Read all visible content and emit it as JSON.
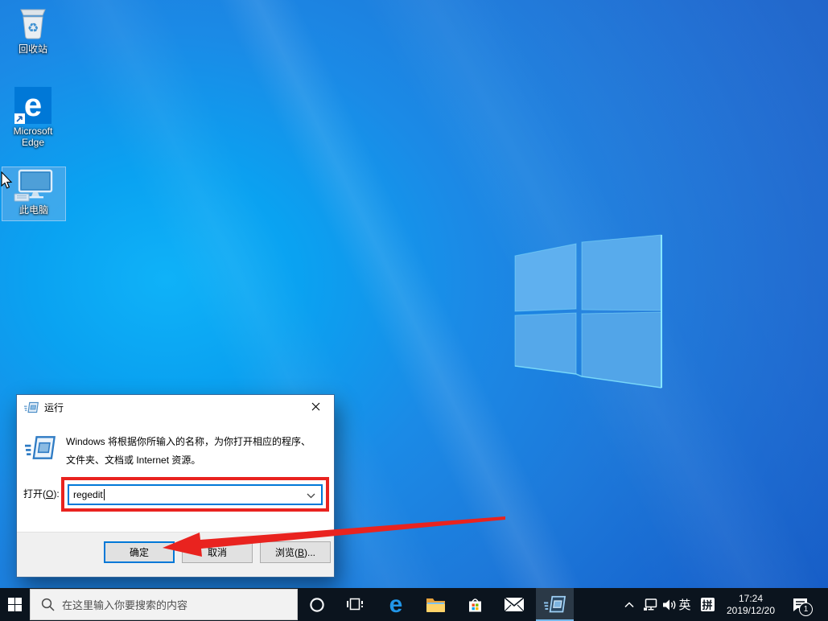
{
  "desktop_icons": [
    {
      "label": "回收站"
    },
    {
      "label": "Microsoft Edge"
    },
    {
      "label": "此电脑",
      "selected": true
    }
  ],
  "icons": {
    "edge_glyph": "e",
    "recycle_glyph": "♻"
  },
  "run_dialog": {
    "title": "运行",
    "message_line1": "Windows 将根据你所输入的名称，为你打开相应的程序、",
    "message_line2": "文件夹、文档或 Internet 资源。",
    "open_label": {
      "prefix": "打开(",
      "key": "O",
      "suffix": "):"
    },
    "input_value": "regedit",
    "buttons": {
      "ok": "确定",
      "cancel": "取消",
      "browse": {
        "prefix": "浏览(",
        "key": "B",
        "suffix": ")..."
      }
    }
  },
  "taskbar": {
    "search_placeholder": "在这里输入你要搜索的内容",
    "tray": {
      "ime_language": "英",
      "ime_mode": "拼",
      "time": "17:24",
      "date": "2019/12/20",
      "notification_count": "1"
    }
  },
  "colors": {
    "accent": "#0078d7",
    "annotation_red": "#e9231f",
    "taskbar_bg": "#0b141e",
    "wallpaper_bright": "#00aaf5",
    "wallpaper_dark": "#0a4db7",
    "logo_fill": "#5aabee",
    "logo_edge": "#86e7ff"
  }
}
